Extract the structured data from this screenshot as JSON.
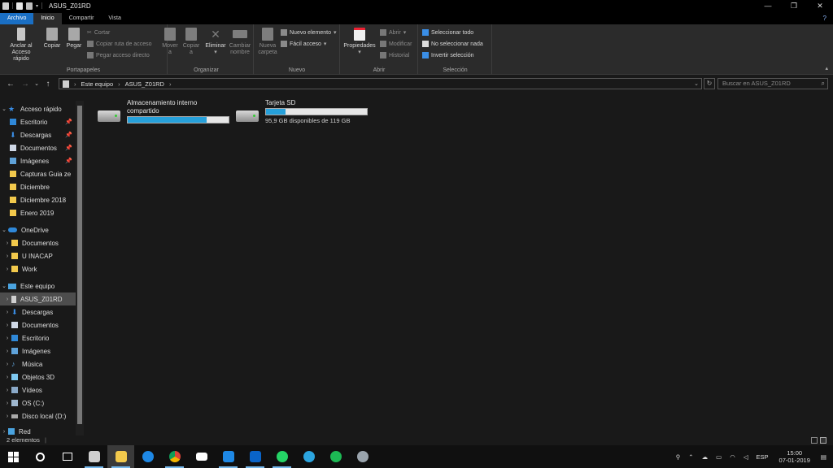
{
  "window": {
    "title": "ASUS_Z01RD",
    "minimize": "—",
    "maximize": "❐",
    "close": "✕"
  },
  "tabs": [
    {
      "label": "Archivo"
    },
    {
      "label": "Inicio"
    },
    {
      "label": "Compartir"
    },
    {
      "label": "Vista"
    }
  ],
  "ribbon": {
    "portapapeles": {
      "label": "Portapapeles",
      "anclar": "Anclar al",
      "anclar2": "Acceso rápido",
      "copiar": "Copiar",
      "pegar": "Pegar",
      "cortar": "Cortar",
      "copiar_ruta": "Copiar ruta de acceso",
      "pegar_acceso": "Pegar acceso directo"
    },
    "organizar": {
      "label": "Organizar",
      "mover": "Mover",
      "mover2": "a",
      "copiar": "Copiar",
      "copiar2": "a",
      "eliminar": "Eliminar",
      "cambiar": "Cambiar",
      "cambiar2": "nombre"
    },
    "nuevo": {
      "label": "Nuevo",
      "nueva": "Nueva",
      "nueva2": "carpeta",
      "nuevo_elemento": "Nuevo elemento",
      "facil_acceso": "Fácil acceso"
    },
    "abrir": {
      "label": "Abrir",
      "propiedades": "Propiedades",
      "abrir": "Abrir",
      "modificar": "Modificar",
      "historial": "Historial"
    },
    "seleccion": {
      "label": "Selección",
      "todo": "Seleccionar todo",
      "nada": "No seleccionar nada",
      "invertir": "Invertir selección"
    }
  },
  "address": {
    "crumbs": [
      "Este equipo",
      "ASUS_Z01RD"
    ],
    "search_placeholder": "Buscar en ASUS_Z01RD"
  },
  "nav": {
    "quick_access": "Acceso rápido",
    "quick_items": [
      "Escritorio",
      "Descargas",
      "Documentos",
      "Imágenes",
      "Capturas Guia ze",
      "Diciembre",
      "Diciembre 2018",
      "Enero 2019"
    ],
    "onedrive": "OneDrive",
    "onedrive_items": [
      "Documentos",
      "U INACAP",
      "Work"
    ],
    "this_pc": "Este equipo",
    "pc_items": [
      "ASUS_Z01RD",
      "Descargas",
      "Documentos",
      "Escritorio",
      "Imágenes",
      "Música",
      "Objetos 3D",
      "Vídeos",
      "OS (C:)",
      "Disco local (D:)"
    ],
    "network": "Red"
  },
  "drives": [
    {
      "name_line1": "Almacenamiento interno",
      "name_line2": "compartido",
      "used_fraction": 0.78,
      "free_text": ""
    },
    {
      "name_line1": "Tarjeta SD",
      "name_line2": "",
      "used_fraction": 0.19,
      "free_text": "95,9 GB disponibles de 119 GB"
    }
  ],
  "status": {
    "count": "2 elementos"
  },
  "taskbar": {
    "input_lang": "ESP",
    "time": "15:00",
    "date": "07-01-2019"
  }
}
